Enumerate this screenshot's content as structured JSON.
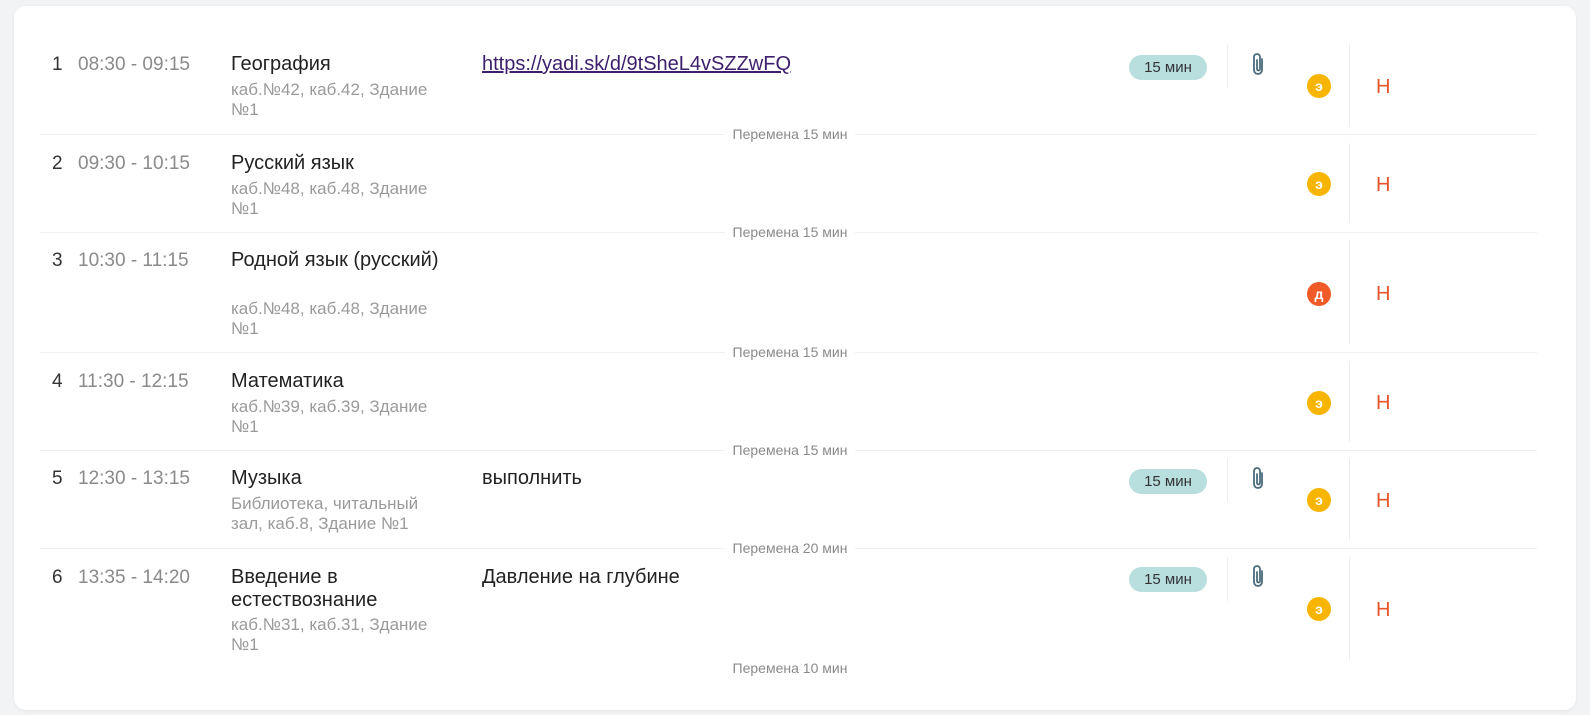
{
  "colors": {
    "badge_e": "#f7b500",
    "badge_d": "#ef5a26",
    "mark": "#e8552b",
    "duration_bg": "#b8dede",
    "link": "#3d1f6b"
  },
  "icons": {
    "attachment": "paperclip-icon"
  },
  "lessons": [
    {
      "number": "1",
      "time": "08:30 - 09:15",
      "subject": "География",
      "room": "каб.№42, каб.42, Здание №1",
      "homework": "https://yadi.sk/d/9tSheL4vSZZwFQ",
      "duration": "15 мин",
      "badge": "э",
      "mark": "Н"
    },
    {
      "number": "2",
      "time": "09:30 - 10:15",
      "subject": "Русский язык",
      "room": "каб.№48, каб.48, Здание №1",
      "homework": "",
      "duration": "",
      "badge": "э",
      "mark": "Н"
    },
    {
      "number": "3",
      "time": "10:30 - 11:15",
      "subject": "Родной язык (русский)",
      "room": "каб.№48, каб.48, Здание №1",
      "homework": "",
      "duration": "",
      "badge": "д",
      "mark": "Н"
    },
    {
      "number": "4",
      "time": "11:30 - 12:15",
      "subject": "Математика",
      "room": "каб.№39, каб.39, Здание №1",
      "homework": "",
      "duration": "",
      "badge": "э",
      "mark": "Н"
    },
    {
      "number": "5",
      "time": "12:30 - 13:15",
      "subject": "Музыка",
      "room": "Библиотека, читальный зал, каб.8, Здание №1",
      "homework": "выполнить",
      "duration": "15 мин",
      "badge": "э",
      "mark": "Н"
    },
    {
      "number": "6",
      "time": "13:35 - 14:20",
      "subject": "Введение в естествознание",
      "room": "каб.№31, каб.31, Здание №1",
      "homework": "Давление на глубине",
      "duration": "15 мин",
      "badge": "э",
      "mark": "Н"
    }
  ],
  "breaks": [
    "Перемена 15 мин",
    "Перемена 15 мин",
    "Перемена 15 мин",
    "Перемена 15 мин",
    "Перемена 20 мин",
    "Перемена 10 мин"
  ]
}
